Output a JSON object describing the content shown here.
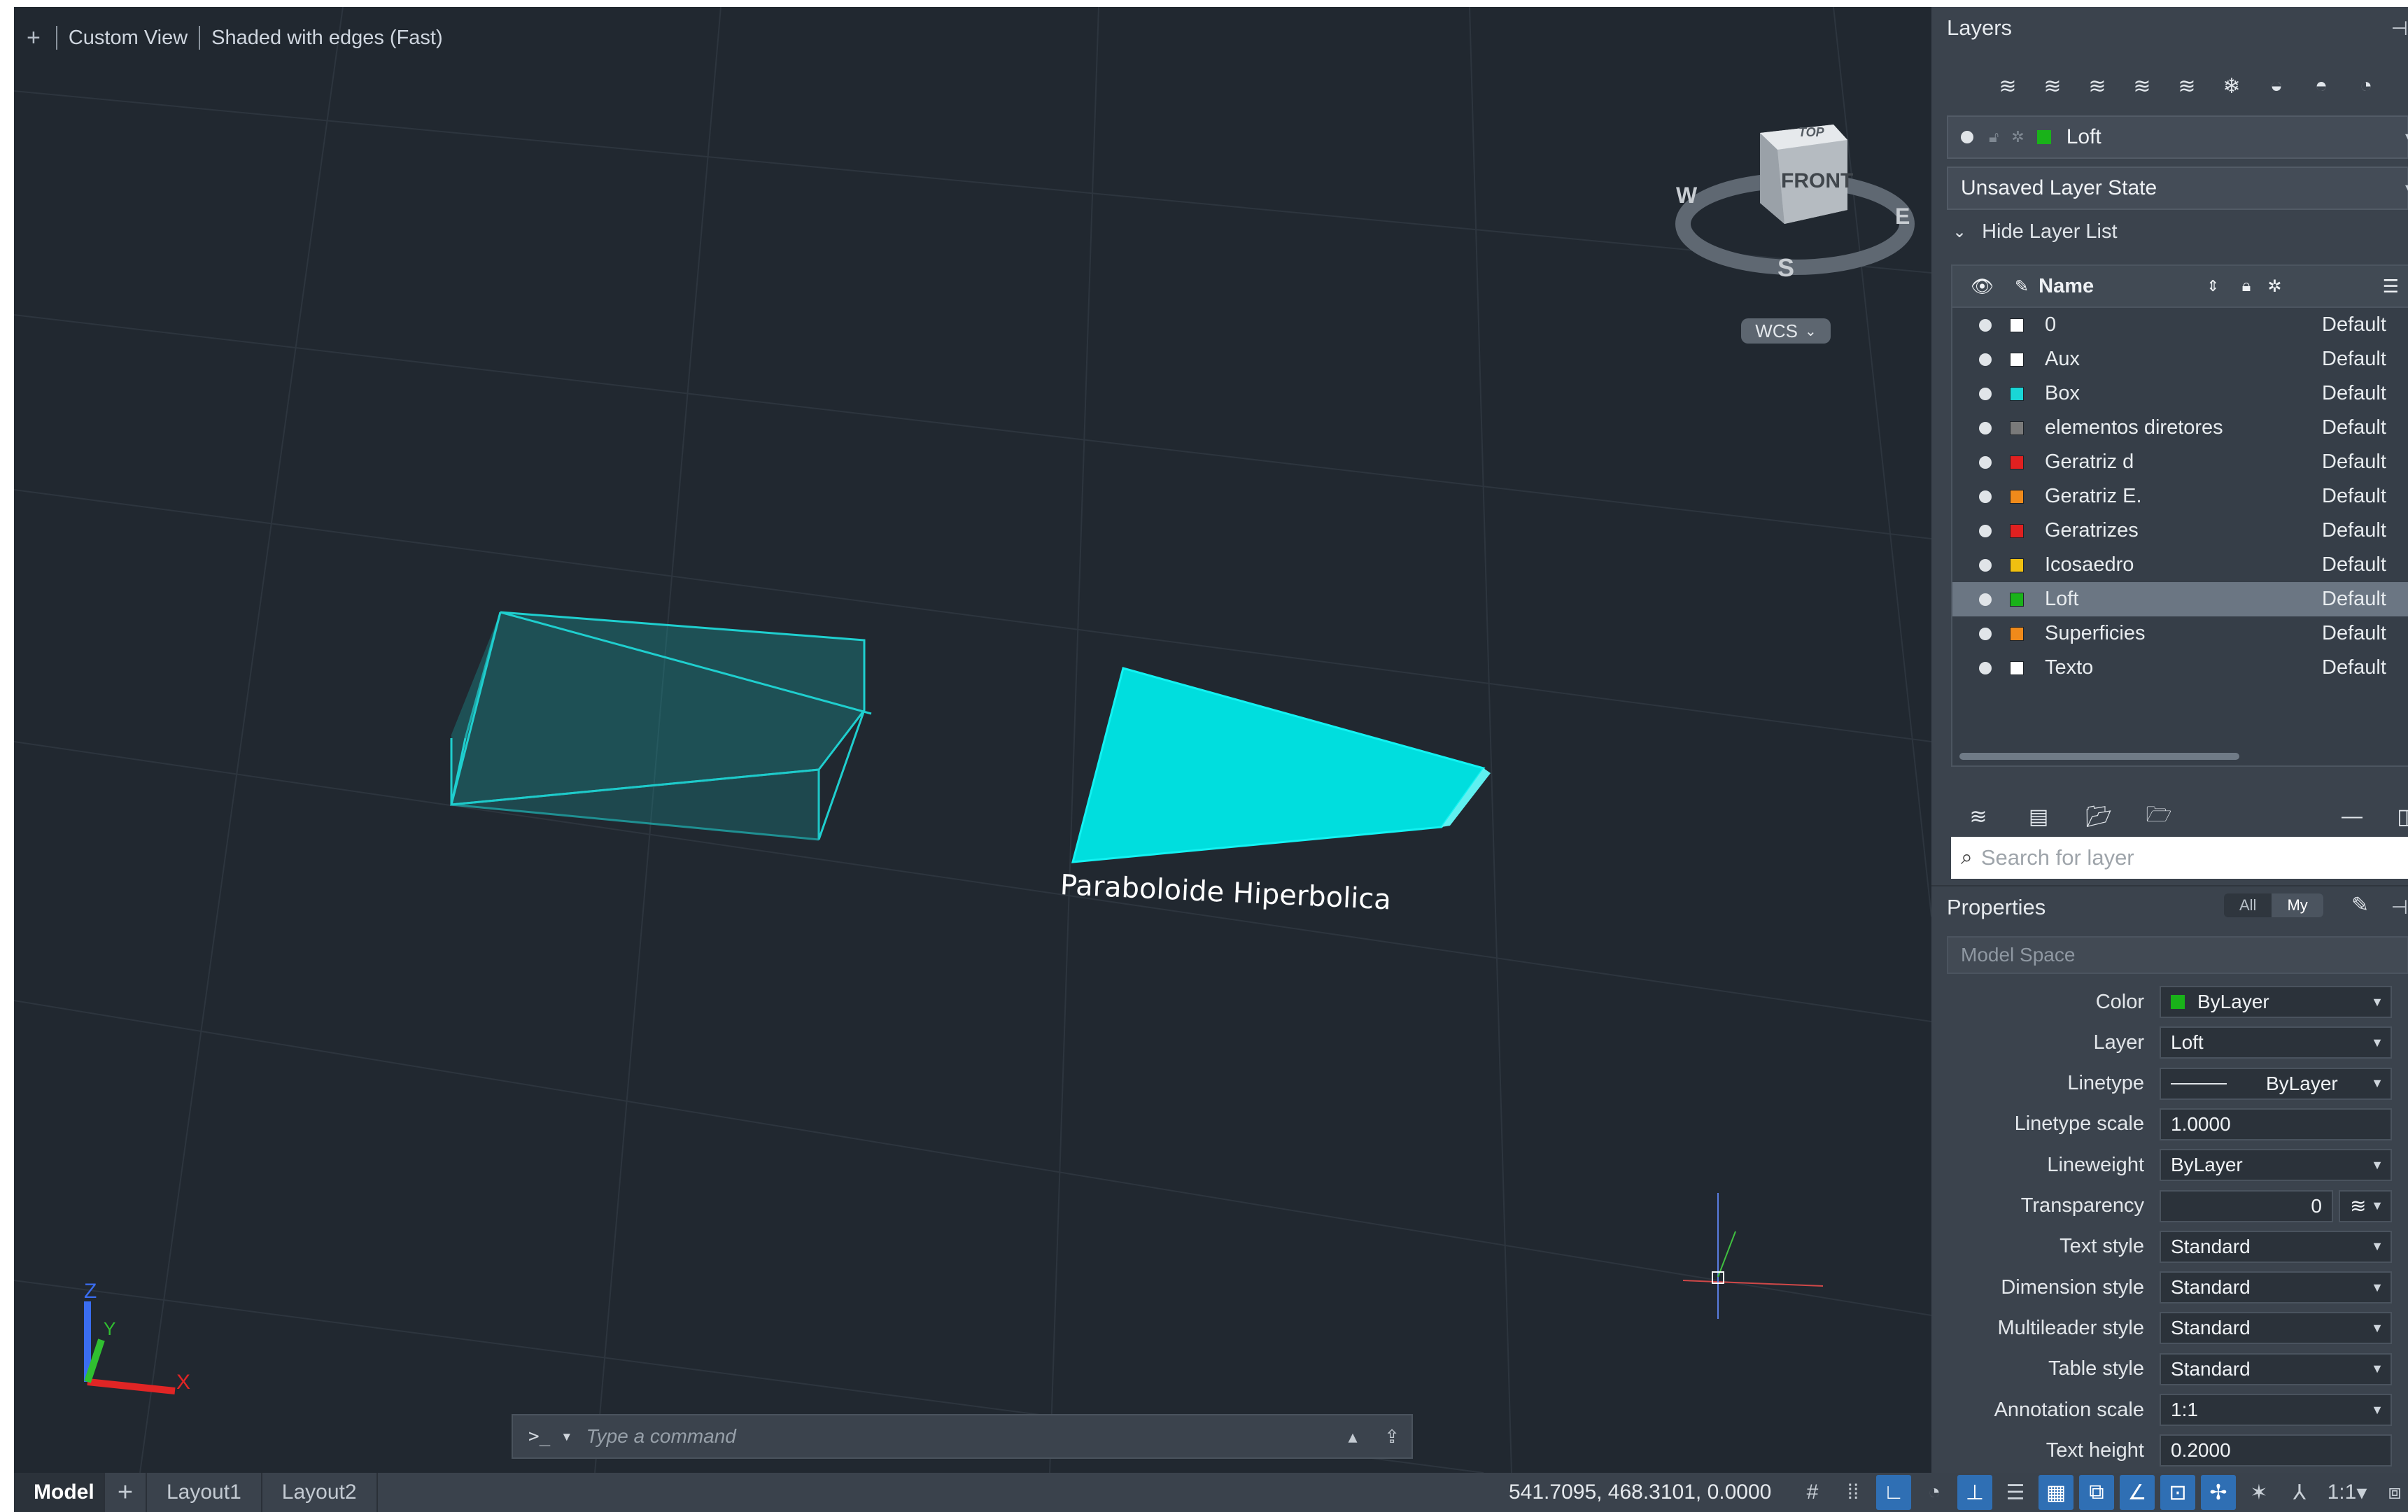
{
  "viewport": {
    "controls": [
      "+",
      "Custom View",
      "Shaded with edges (Fast)"
    ],
    "viewcube": {
      "top": "TOP",
      "front": "FRONT",
      "west": "W",
      "east": "E",
      "south": "S"
    },
    "wcs_label": "WCS",
    "object_label": "Paraboloide Hiperbolica",
    "ucs_axes": {
      "x": "X",
      "y": "Y",
      "z": "Z"
    },
    "shape_color": "#00e0e0"
  },
  "command_line": {
    "prompt": ">_",
    "placeholder": "Type a command"
  },
  "status_bar": {
    "tabs": [
      "Model",
      "+",
      "Layout1",
      "Layout2"
    ],
    "coordinates": "541.7095, 468.3101, 0.0000",
    "scale": "1:1"
  },
  "layers_panel": {
    "title": "Layers",
    "current_layer": "Loft",
    "current_layer_color": "#19b219",
    "layer_state": "Unsaved Layer State",
    "hide_toggle": "Hide Layer List",
    "column_name": "Name",
    "layers": [
      {
        "name": "0",
        "color": "#ffffff",
        "state": "Default"
      },
      {
        "name": "Aux",
        "color": "#ffffff",
        "state": "Default"
      },
      {
        "name": "Box",
        "color": "#19d6d6",
        "state": "Default"
      },
      {
        "name": "elementos diretores",
        "color": "#7a7a7a",
        "state": "Default"
      },
      {
        "name": "Geratriz d",
        "color": "#e02020",
        "state": "Default"
      },
      {
        "name": "Geratriz E.",
        "color": "#f08a1a",
        "state": "Default"
      },
      {
        "name": "Geratrizes",
        "color": "#e02020",
        "state": "Default"
      },
      {
        "name": "Icosaedro",
        "color": "#f0c010",
        "state": "Default"
      },
      {
        "name": "Loft",
        "color": "#19b219",
        "state": "Default",
        "selected": true
      },
      {
        "name": "Superficies",
        "color": "#f08a1a",
        "state": "Default"
      },
      {
        "name": "Texto",
        "color": "#ffffff",
        "state": "Default"
      }
    ],
    "search_placeholder": "Search for layer"
  },
  "properties_panel": {
    "title": "Properties",
    "filter_all": "All",
    "filter_my": "My",
    "space": "Model Space",
    "rows": [
      {
        "label": "Color",
        "value": "ByLayer",
        "swatch": "#19b219"
      },
      {
        "label": "Layer",
        "value": "Loft"
      },
      {
        "label": "Linetype",
        "value": "ByLayer"
      },
      {
        "label": "Linetype scale",
        "value": "1.0000"
      },
      {
        "label": "Lineweight",
        "value": "ByLayer"
      },
      {
        "label": "Transparency",
        "value": "0"
      },
      {
        "label": "Text style",
        "value": "Standard"
      },
      {
        "label": "Dimension style",
        "value": "Standard"
      },
      {
        "label": "Multileader style",
        "value": "Standard"
      },
      {
        "label": "Table style",
        "value": "Standard"
      },
      {
        "label": "Annotation scale",
        "value": "1:1"
      },
      {
        "label": "Text height",
        "value": "0.2000"
      }
    ]
  }
}
